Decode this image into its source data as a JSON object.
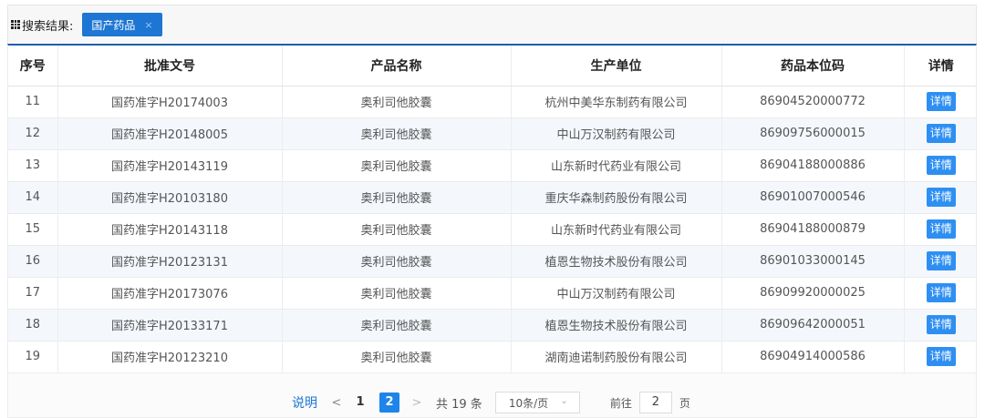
{
  "search": {
    "label": "搜索结果:",
    "tag_label": "国产药品",
    "tag_close": "×"
  },
  "table": {
    "headers": [
      "序号",
      "批准文号",
      "产品名称",
      "生产单位",
      "药品本位码",
      "详情"
    ],
    "rows": [
      {
        "no": "11",
        "approval": "国药准字H20174003",
        "product": "奥利司他胶囊",
        "manufacturer": "杭州中美华东制药有限公司",
        "code": "86904520000772",
        "detail": "详情"
      },
      {
        "no": "12",
        "approval": "国药准字H20148005",
        "product": "奥利司他胶囊",
        "manufacturer": "中山万汉制药有限公司",
        "code": "86909756000015",
        "detail": "详情"
      },
      {
        "no": "13",
        "approval": "国药准字H20143119",
        "product": "奥利司他胶囊",
        "manufacturer": "山东新时代药业有限公司",
        "code": "86904188000886",
        "detail": "详情"
      },
      {
        "no": "14",
        "approval": "国药准字H20103180",
        "product": "奥利司他胶囊",
        "manufacturer": "重庆华森制药股份有限公司",
        "code": "86901007000546",
        "detail": "详情"
      },
      {
        "no": "15",
        "approval": "国药准字H20143118",
        "product": "奥利司他胶囊",
        "manufacturer": "山东新时代药业有限公司",
        "code": "86904188000879",
        "detail": "详情"
      },
      {
        "no": "16",
        "approval": "国药准字H20123131",
        "product": "奥利司他胶囊",
        "manufacturer": "植恩生物技术股份有限公司",
        "code": "86901033000145",
        "detail": "详情"
      },
      {
        "no": "17",
        "approval": "国药准字H20173076",
        "product": "奥利司他胶囊",
        "manufacturer": "中山万汉制药有限公司",
        "code": "86909920000025",
        "detail": "详情"
      },
      {
        "no": "18",
        "approval": "国药准字H20133171",
        "product": "奥利司他胶囊",
        "manufacturer": "植恩生物技术股份有限公司",
        "code": "86909642000051",
        "detail": "详情"
      },
      {
        "no": "19",
        "approval": "国药准字H20123210",
        "product": "奥利司他胶囊",
        "manufacturer": "湖南迪诺制药股份有限公司",
        "code": "86904914000586",
        "detail": "详情"
      }
    ]
  },
  "pager": {
    "explain": "说明",
    "prev": "<",
    "next": ">",
    "pages": [
      "1",
      "2"
    ],
    "current_page": "2",
    "total": "共 19 条",
    "page_size": "10条/页",
    "goto_label": "前往",
    "goto_value": "2",
    "goto_unit": "页"
  },
  "colors": {
    "accent": "#1d76d3",
    "header_rule": "#1c5fab",
    "detail_button": "#2e8ff2",
    "row_stripe": "#f4f8fd"
  },
  "icons": {
    "search_prefix": "grid-icon",
    "tag_close": "close-icon",
    "page_size_dropdown": "chevron-down-icon"
  }
}
